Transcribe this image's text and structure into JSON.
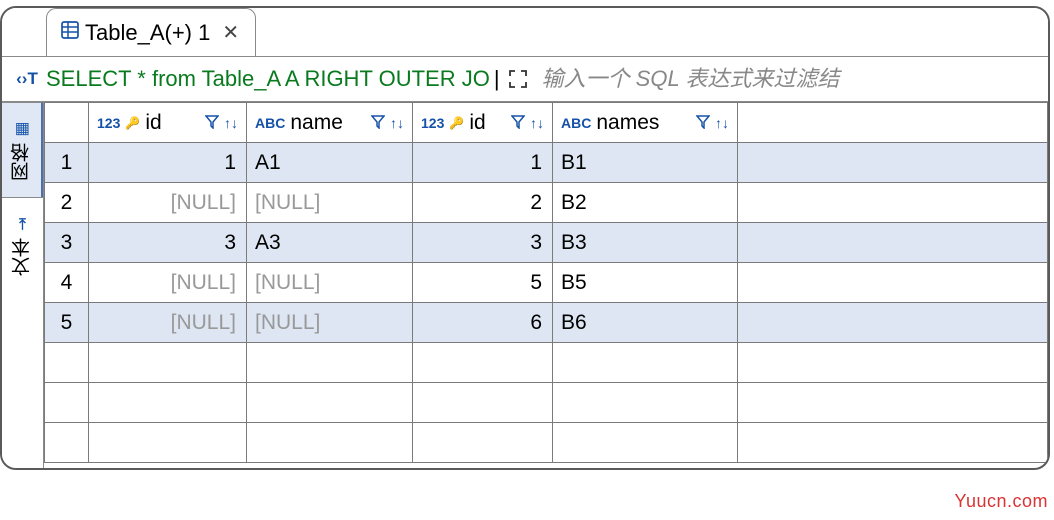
{
  "tab": {
    "title": "Table_A(+) 1"
  },
  "sql": {
    "query": "SELECT * from Table_A A RIGHT OUTER JO",
    "placeholder": "输入一个 SQL 表达式来过滤结"
  },
  "side_tabs": {
    "grid": "网格",
    "text": "文本"
  },
  "columns": [
    {
      "type": "123",
      "name": "id",
      "key": true
    },
    {
      "type": "ABC",
      "name": "name",
      "key": false
    },
    {
      "type": "123",
      "name": "id",
      "key": true
    },
    {
      "type": "ABC",
      "name": "names",
      "key": false
    }
  ],
  "rows": [
    {
      "n": "1",
      "c": [
        "1",
        "A1",
        "1",
        "B1"
      ],
      "null": [
        false,
        false,
        false,
        false
      ]
    },
    {
      "n": "2",
      "c": [
        "[NULL]",
        "[NULL]",
        "2",
        "B2"
      ],
      "null": [
        true,
        true,
        false,
        false
      ]
    },
    {
      "n": "3",
      "c": [
        "3",
        "A3",
        "3",
        "B3"
      ],
      "null": [
        false,
        false,
        false,
        false
      ]
    },
    {
      "n": "4",
      "c": [
        "[NULL]",
        "[NULL]",
        "5",
        "B5"
      ],
      "null": [
        true,
        true,
        false,
        false
      ]
    },
    {
      "n": "5",
      "c": [
        "[NULL]",
        "[NULL]",
        "6",
        "B6"
      ],
      "null": [
        true,
        true,
        false,
        false
      ]
    }
  ],
  "watermark": "Yuucn.com"
}
